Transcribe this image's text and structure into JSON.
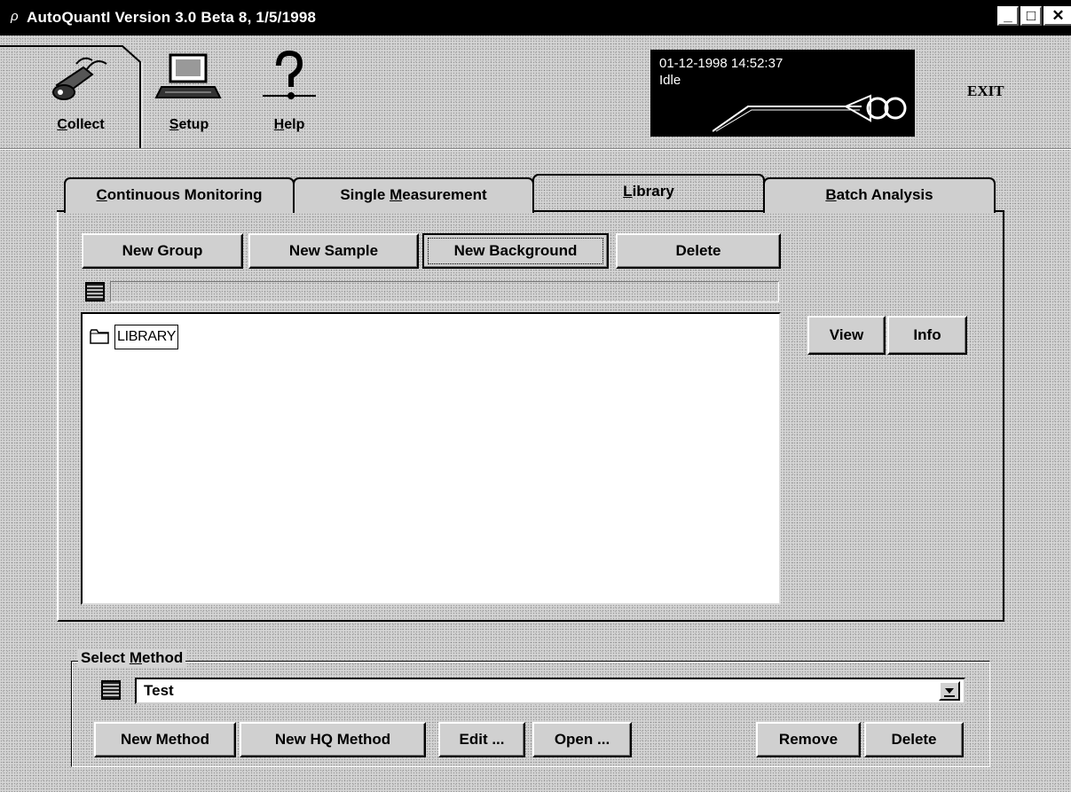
{
  "window": {
    "icon": "ρ",
    "title": "AutoQuantI  Version 3.0 Beta 8, 1/5/1998",
    "minimize_label": "_",
    "maximize_label": "□",
    "close_label": "✕"
  },
  "toolbar": {
    "collect": {
      "mnemonic": "C",
      "rest": "ollect",
      "icon": "probe-icon"
    },
    "setup": {
      "mnemonic": "S",
      "rest": "etup",
      "icon": "computer-icon"
    },
    "help": {
      "mnemonic": "H",
      "rest": "elp",
      "icon": "question-mark-icon"
    },
    "exit_label": "EXIT"
  },
  "status": {
    "datetime": "01-12-1998  14:52:37",
    "state": "Idle"
  },
  "tabs": [
    {
      "mnemonic": "C",
      "rest": "ontinuous Monitoring"
    },
    {
      "prefix": "Single ",
      "mnemonic": "M",
      "rest": "easurement"
    },
    {
      "mnemonic": "L",
      "rest": "ibrary",
      "selected": true
    },
    {
      "mnemonic": "B",
      "rest": "atch Analysis"
    }
  ],
  "library": {
    "new_group": "New Group",
    "new_sample": "New Sample",
    "new_background": "New Background",
    "delete": "Delete",
    "view": "View",
    "info": "Info",
    "path": "",
    "tree_root": "LIBRARY"
  },
  "method": {
    "legend_prefix": "Select ",
    "legend_mnemonic": "M",
    "legend_rest": "ethod",
    "selected_value": "Test",
    "new_method": "New Method",
    "new_hq_method": "New HQ Method",
    "edit": "Edit ...",
    "open": "Open ...",
    "remove": "Remove",
    "delete": "Delete"
  }
}
